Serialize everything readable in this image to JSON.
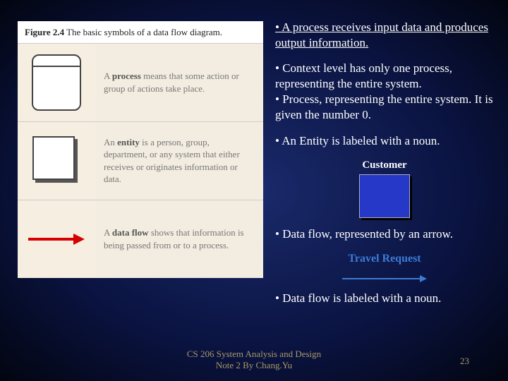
{
  "figure": {
    "caption_bold": "Figure 2.4",
    "caption_rest": "The basic symbols of a data flow diagram.",
    "rows": [
      {
        "term": "process",
        "rest": " means that some action or group of actions take place."
      },
      {
        "term": "entity",
        "rest": " is a person, group, department, or any system that either receives or originates information or data."
      },
      {
        "term": "data flow",
        "rest": " shows that information is being passed from or to a process."
      }
    ]
  },
  "bullets": {
    "b1": "• A process receives input data and produces output information.",
    "b2": "• Context level has only one process, representing the entire system.",
    "b3": "• Process, representing the entire system. It is given the number 0.",
    "b4": "• An Entity is labeled with a noun.",
    "b5": "•  Data flow, represented by an arrow.",
    "b6": "• Data flow is labeled with a noun."
  },
  "labels": {
    "customer": "Customer",
    "travel": "Travel Request"
  },
  "footer": {
    "line1": "CS 206 System Analysis and Design",
    "line2": "Note 2 By Chang.Yu",
    "page": "23"
  }
}
